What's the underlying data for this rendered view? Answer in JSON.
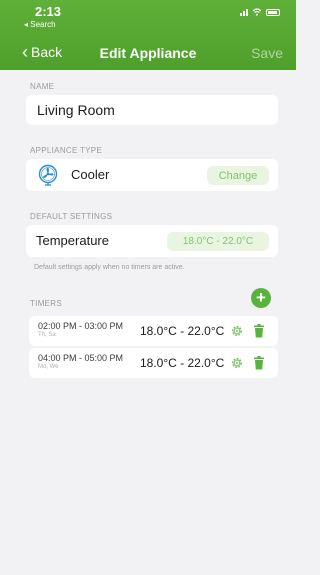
{
  "status_bar": {
    "time": "2:13",
    "back_app": "◂ Search"
  },
  "nav": {
    "back_label": "Back",
    "title": "Edit Appliance",
    "save_label": "Save"
  },
  "name_section": {
    "label": "NAME",
    "value": "Living Room"
  },
  "type_section": {
    "label": "APPLIANCE TYPE",
    "type_name": "Cooler",
    "type_icon": "fan-icon",
    "change_label": "Change"
  },
  "default_section": {
    "label": "DEFAULT SETTINGS",
    "setting_label": "Temperature",
    "setting_value": "18.0°C - 22.0°C",
    "hint": "Default settings apply when no timers are active."
  },
  "timers_section": {
    "label": "TIMERS",
    "add_icon": "plus-icon",
    "items": [
      {
        "range": "02:00 PM - 03:00 PM",
        "days": "Th, Sa",
        "temp": "18.0°C - 22.0°C"
      },
      {
        "range": "04:00 PM - 05:00 PM",
        "days": "Mo, We",
        "temp": "18.0°C - 22.0°C"
      }
    ]
  },
  "colors": {
    "header": "#4f9f2c",
    "accent": "#58b33d",
    "pill_bg": "#eaf5e1",
    "pill_text": "#7ec46a",
    "background": "#f2f2f4"
  }
}
